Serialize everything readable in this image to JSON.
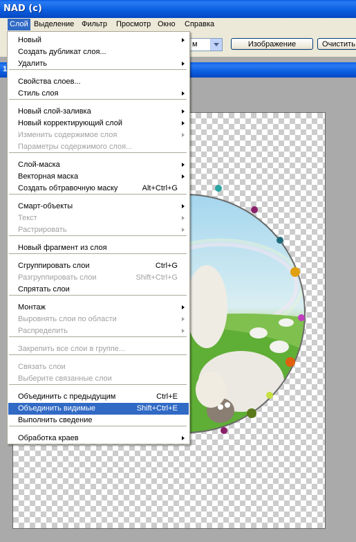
{
  "window": {
    "title": "NAD (c)"
  },
  "menubar": {
    "items": [
      "Слой",
      "Выделение",
      "Фильтр",
      "Просмотр",
      "Окно",
      "Справка"
    ],
    "active": "Слой"
  },
  "options": {
    "combo_value": "м",
    "image_button": "Изображение",
    "clear_button": "Очистить"
  },
  "document": {
    "tab_label": "1"
  },
  "layer_menu": {
    "items": [
      {
        "label": "Новый",
        "shortcut": "",
        "submenu": true,
        "enabled": true
      },
      {
        "label": "Создать дубликат слоя...",
        "shortcut": "",
        "submenu": false,
        "enabled": true
      },
      {
        "label": "Удалить",
        "shortcut": "",
        "submenu": true,
        "enabled": true
      },
      {
        "label": "Свойства слоев...",
        "shortcut": "",
        "submenu": false,
        "enabled": true
      },
      {
        "label": "Стиль слоя",
        "shortcut": "",
        "submenu": true,
        "enabled": true
      },
      {
        "label": "Новый слой-заливка",
        "shortcut": "",
        "submenu": true,
        "enabled": true
      },
      {
        "label": "Новый корректирующий слой",
        "shortcut": "",
        "submenu": true,
        "enabled": true
      },
      {
        "label": "Изменить содержимое слоя",
        "shortcut": "",
        "submenu": true,
        "enabled": false
      },
      {
        "label": "Параметры содержимого слоя...",
        "shortcut": "",
        "submenu": false,
        "enabled": false
      },
      {
        "label": "Слой-маска",
        "shortcut": "",
        "submenu": true,
        "enabled": true
      },
      {
        "label": "Векторная маска",
        "shortcut": "",
        "submenu": true,
        "enabled": true
      },
      {
        "label": "Создать обтравочную маску",
        "shortcut": "Alt+Ctrl+G",
        "submenu": false,
        "enabled": true
      },
      {
        "label": "Смарт-объекты",
        "shortcut": "",
        "submenu": true,
        "enabled": true
      },
      {
        "label": "Текст",
        "shortcut": "",
        "submenu": true,
        "enabled": false
      },
      {
        "label": "Растрировать",
        "shortcut": "",
        "submenu": true,
        "enabled": false
      },
      {
        "label": "Новый фрагмент из слоя",
        "shortcut": "",
        "submenu": false,
        "enabled": true
      },
      {
        "label": "Сгруппировать слои",
        "shortcut": "Ctrl+G",
        "submenu": false,
        "enabled": true
      },
      {
        "label": "Разгруппировать слои",
        "shortcut": "Shift+Ctrl+G",
        "submenu": false,
        "enabled": false
      },
      {
        "label": "Спрятать слои",
        "shortcut": "",
        "submenu": false,
        "enabled": true
      },
      {
        "label": "Монтаж",
        "shortcut": "",
        "submenu": true,
        "enabled": true
      },
      {
        "label": "Выровнять слои по области",
        "shortcut": "",
        "submenu": true,
        "enabled": false
      },
      {
        "label": "Распределить",
        "shortcut": "",
        "submenu": true,
        "enabled": false
      },
      {
        "label": "Закрепить все слои в группе...",
        "shortcut": "",
        "submenu": false,
        "enabled": false
      },
      {
        "label": "Связать слои",
        "shortcut": "",
        "submenu": false,
        "enabled": false
      },
      {
        "label": "Выберите связанные слои",
        "shortcut": "",
        "submenu": false,
        "enabled": false
      },
      {
        "label": "Объединить с предыдущим",
        "shortcut": "Ctrl+E",
        "submenu": false,
        "enabled": true
      },
      {
        "label": "Объединить видимые",
        "shortcut": "Shift+Ctrl+E",
        "submenu": false,
        "enabled": true,
        "highlighted": true
      },
      {
        "label": "Выполнить сведение",
        "shortcut": "",
        "submenu": false,
        "enabled": true
      },
      {
        "label": "Обработка краев",
        "shortcut": "",
        "submenu": true,
        "enabled": true
      }
    ]
  },
  "colors": {
    "title_bar": "#0b5fe0",
    "menu_highlight": "#316ac5",
    "menu_disabled": "#a0a0a0"
  }
}
